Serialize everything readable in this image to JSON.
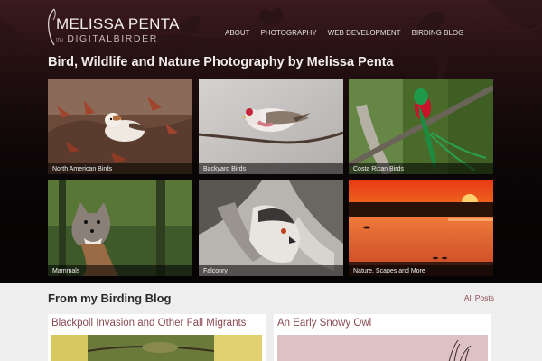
{
  "brand": {
    "name": "MELISSA PENTA",
    "tagline": "DIGITALBIRDER",
    "tagline_prefix": "the"
  },
  "nav": {
    "items": [
      "ABOUT",
      "PHOTOGRAPHY",
      "WEB DEVELOPMENT",
      "BIRDING BLOG"
    ]
  },
  "headline": "Bird, Wildlife and Nature Photography by Melissa Penta",
  "galleries": [
    {
      "caption": "North American Birds",
      "icon": "snow-bunting-photo"
    },
    {
      "caption": "Backyard Birds",
      "icon": "redpoll-photo"
    },
    {
      "caption": "Costa Rican Birds",
      "icon": "quetzal-photo"
    },
    {
      "caption": "Mammals",
      "icon": "fox-photo"
    },
    {
      "caption": "Falconry",
      "icon": "hawk-photo"
    },
    {
      "caption": "Nature, Scapes and More",
      "icon": "sunset-photo"
    }
  ],
  "blog": {
    "title": "From my Birding Blog",
    "all_posts_label": "All Posts",
    "posts": [
      {
        "title": "Blackpoll Invasion and Other Fall Migrants",
        "icon": "blackpoll-photo"
      },
      {
        "title": "An Early Snowy Owl",
        "icon": "snowy-owl-photo"
      }
    ]
  },
  "colors": {
    "header_dark": "#0a0506",
    "header_accent": "#3a1a1c",
    "link": "#8a4a52",
    "blog_bg": "#efeeee"
  }
}
